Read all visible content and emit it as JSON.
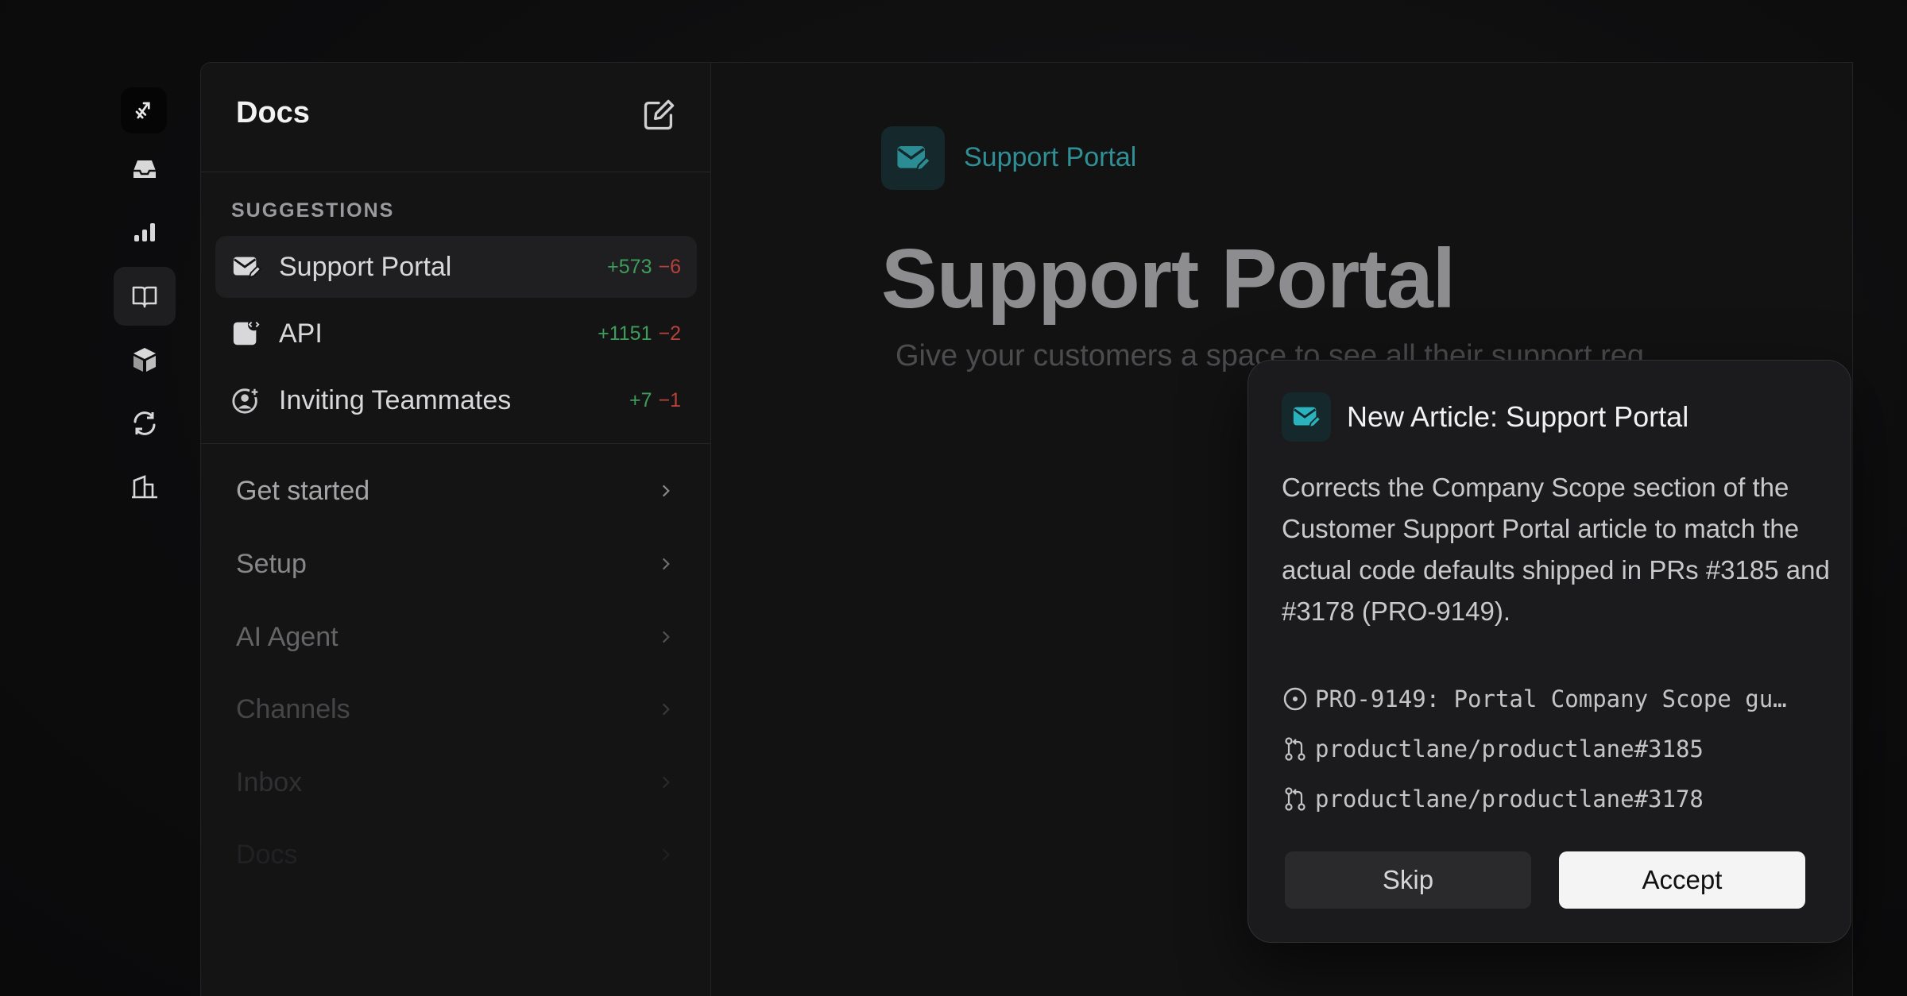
{
  "sidebar": {
    "title": "Docs",
    "suggestions_label": "SUGGESTIONS",
    "suggestions": [
      {
        "label": "Support Portal",
        "plus": "+573",
        "minus": "−6",
        "icon": "mail-edit-icon"
      },
      {
        "label": "API",
        "plus": "+1151",
        "minus": "−2",
        "icon": "code-file-icon"
      },
      {
        "label": "Inviting Teammates",
        "plus": "+7",
        "minus": "−1",
        "icon": "user-add-icon"
      }
    ],
    "nav": [
      {
        "label": "Get started"
      },
      {
        "label": "Setup"
      },
      {
        "label": "AI Agent"
      },
      {
        "label": "Channels"
      },
      {
        "label": "Inbox"
      },
      {
        "label": "Docs"
      }
    ]
  },
  "rail": {
    "icons": [
      "logo-icon",
      "inbox-icon",
      "chart-icon",
      "book-icon",
      "cube-icon",
      "refresh-icon",
      "building-icon"
    ],
    "active": "book-icon"
  },
  "main": {
    "breadcrumb": "Support Portal",
    "title": "Support Portal",
    "subtitle": "Give your customers a space to see all their support req"
  },
  "dialog": {
    "title": "New Article: Support Portal",
    "body": "Corrects the Company Scope section of the Customer Support Portal article to match the actual code defaults shipped in PRs #3185 and #3178 (PRO-9149).",
    "refs": [
      {
        "icon": "issue-icon",
        "text": "PRO-9149: Portal Company Scope gu…"
      },
      {
        "icon": "pull-request-icon",
        "text": "productlane/productlane#3185"
      },
      {
        "icon": "pull-request-icon",
        "text": "productlane/productlane#3178"
      }
    ],
    "skip_label": "Skip",
    "accept_label": "Accept"
  },
  "colors": {
    "accent": "#2f8f95",
    "plus": "#3f9d5c",
    "minus": "#b8413b"
  }
}
